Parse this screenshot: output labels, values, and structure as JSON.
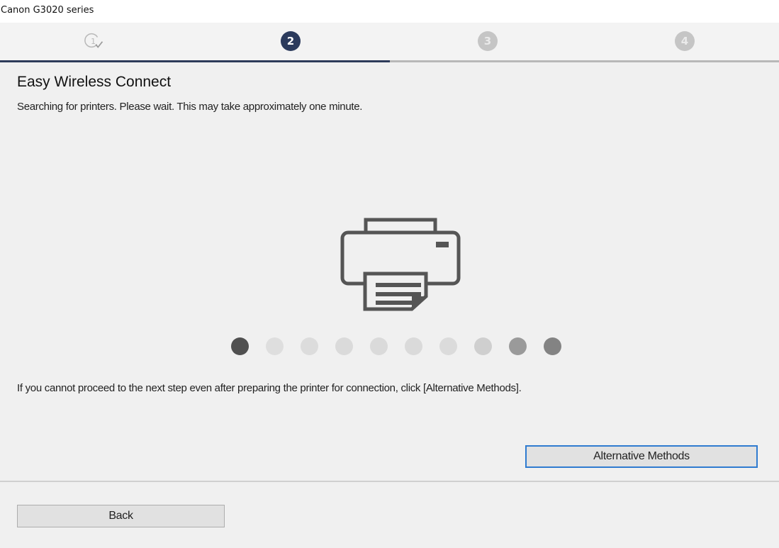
{
  "window": {
    "title": "Canon G3020 series"
  },
  "steps": [
    {
      "label": "1",
      "state": "done"
    },
    {
      "label": "2",
      "state": "active"
    },
    {
      "label": "3",
      "state": "pending"
    },
    {
      "label": "4",
      "state": "pending"
    }
  ],
  "progress": {
    "current_step": 2,
    "total_steps": 4,
    "fraction": 0.5
  },
  "main": {
    "heading": "Easy Wireless Connect",
    "status_text": "Searching for printers. Please wait. This may take approximately one minute.",
    "help_text": "If you cannot proceed to the next step even after preparing the printer for connection, click [Alternative Methods].",
    "loading_dots": [
      {
        "shade": "#505050"
      },
      {
        "shade": "#dedede"
      },
      {
        "shade": "#dcdcdc"
      },
      {
        "shade": "#dadada"
      },
      {
        "shade": "#dadada"
      },
      {
        "shade": "#dadada"
      },
      {
        "shade": "#dbdbdb"
      },
      {
        "shade": "#cfcfcf"
      },
      {
        "shade": "#9a9a9a"
      },
      {
        "shade": "#838383"
      }
    ]
  },
  "buttons": {
    "alternative_methods": "Alternative Methods",
    "back": "Back"
  },
  "colors": {
    "accent": "#2b3a5c",
    "focus_border": "#2f7bd0"
  }
}
